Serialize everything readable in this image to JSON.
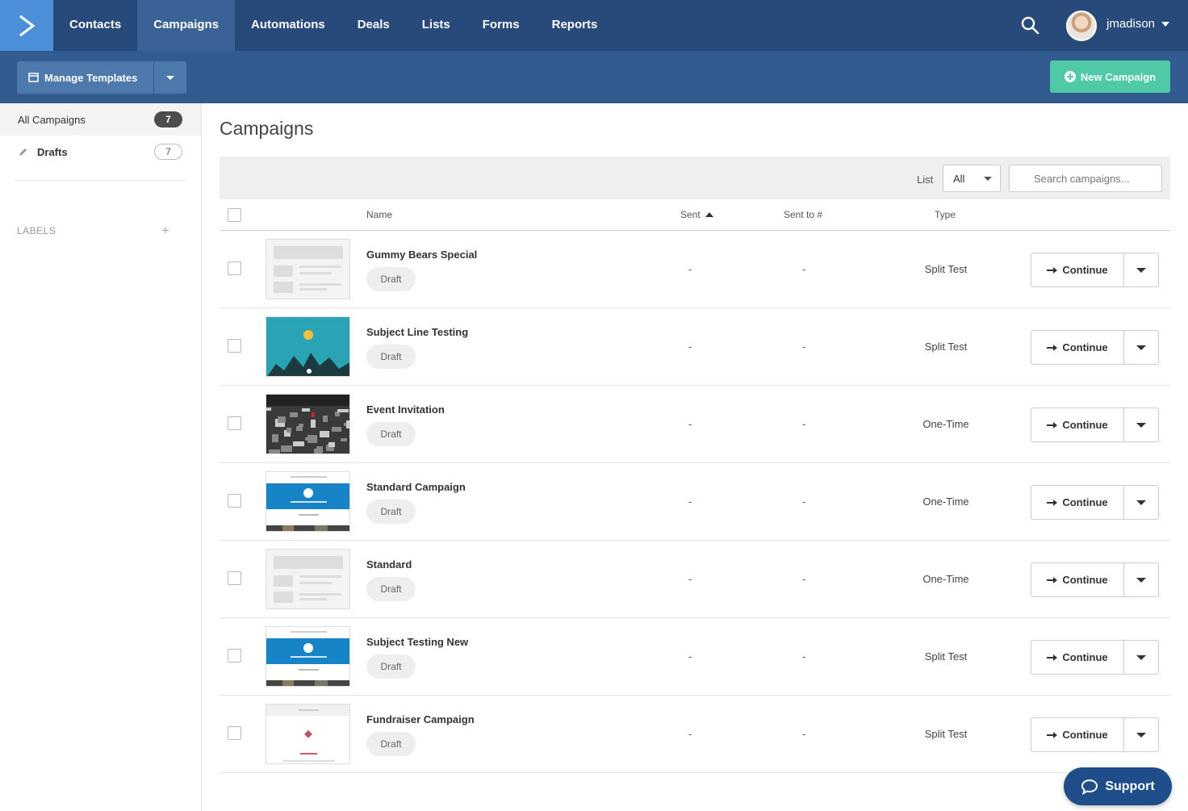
{
  "nav": {
    "items": [
      {
        "label": "Contacts",
        "active": false
      },
      {
        "label": "Campaigns",
        "active": true
      },
      {
        "label": "Automations",
        "active": false
      },
      {
        "label": "Deals",
        "active": false
      },
      {
        "label": "Lists",
        "active": false
      },
      {
        "label": "Forms",
        "active": false
      },
      {
        "label": "Reports",
        "active": false
      }
    ],
    "username": "jmadison"
  },
  "toolbar": {
    "manage_templates": "Manage Templates",
    "new_campaign": "New Campaign"
  },
  "sidebar": {
    "items": [
      {
        "label": "All Campaigns",
        "count": "7"
      },
      {
        "label": "Drafts",
        "count": "7"
      }
    ],
    "labels_heading": "LABELS"
  },
  "main": {
    "title": "Campaigns",
    "filter": {
      "list_label": "List",
      "list_value": "All",
      "search_placeholder": "Search campaigns..."
    },
    "columns": {
      "name": "Name",
      "sent": "Sent",
      "sent_to": "Sent to #",
      "type": "Type"
    },
    "campaigns": [
      {
        "name": "Gummy Bears Special",
        "status": "Draft",
        "sent": "-",
        "sent_to": "-",
        "type": "Split Test",
        "thumb": "blank"
      },
      {
        "name": "Subject Line Testing",
        "status": "Draft",
        "sent": "-",
        "sent_to": "-",
        "type": "Split Test",
        "thumb": "mountain"
      },
      {
        "name": "Event Invitation",
        "status": "Draft",
        "sent": "-",
        "sent_to": "-",
        "type": "One-Time",
        "thumb": "city"
      },
      {
        "name": "Standard Campaign",
        "status": "Draft",
        "sent": "-",
        "sent_to": "-",
        "type": "One-Time",
        "thumb": "blue"
      },
      {
        "name": "Standard",
        "status": "Draft",
        "sent": "-",
        "sent_to": "-",
        "type": "One-Time",
        "thumb": "blank"
      },
      {
        "name": "Subject Testing New",
        "status": "Draft",
        "sent": "-",
        "sent_to": "-",
        "type": "Split Test",
        "thumb": "blue"
      },
      {
        "name": "Fundraiser Campaign",
        "status": "Draft",
        "sent": "-",
        "sent_to": "-",
        "type": "Split Test",
        "thumb": "fund"
      }
    ],
    "continue_label": "Continue"
  },
  "support_label": "Support",
  "colors": {
    "nav_bg": "#274a7a",
    "subbar_bg": "#325c8f",
    "accent_green": "#4fc9a8",
    "logo_bg": "#4a8fd8",
    "support_bg": "#1f4d8a"
  }
}
